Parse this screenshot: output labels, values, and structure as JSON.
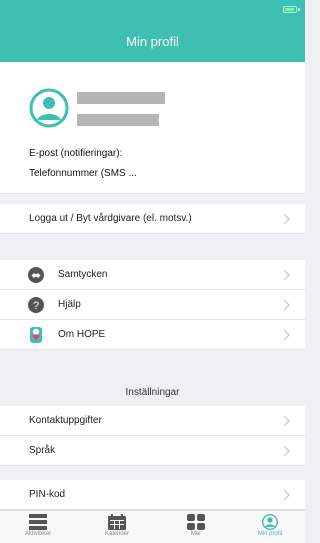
{
  "nav": {
    "title": "Min profil"
  },
  "profile": {
    "email_label": "E-post (notifieringar):",
    "phone_label": "Telefonnummer (SMS ..."
  },
  "account": {
    "logout_label": "Logga ut / Byt vårdgivare (el. motsv.)"
  },
  "menu": {
    "items": [
      {
        "label": "Samtycken",
        "icon": "handshake-icon"
      },
      {
        "label": "Hjälp",
        "icon": "question-icon"
      },
      {
        "label": "Om HOPE",
        "icon": "hope-logo-icon"
      }
    ]
  },
  "settings": {
    "header": "Inställningar",
    "items": [
      {
        "label": "Kontaktuppgifter"
      },
      {
        "label": "Språk"
      },
      {
        "label": "PIN-kod"
      }
    ]
  },
  "tabbar": {
    "active_color": "#3dbfb1",
    "tabs": [
      {
        "label": "Aktiviteter",
        "icon": "list-icon"
      },
      {
        "label": "Kalender",
        "icon": "calendar-icon"
      },
      {
        "label": "Mer",
        "icon": "grid-icon"
      },
      {
        "label": "Min profil",
        "icon": "person-icon",
        "active": true
      }
    ]
  },
  "colors": {
    "accent": "#3dbfb1",
    "background": "#efeff4"
  }
}
